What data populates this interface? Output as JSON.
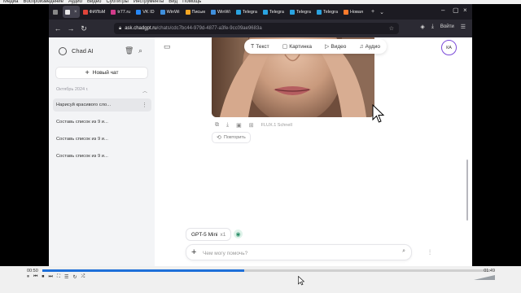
{
  "player": {
    "menu": [
      "Медиа",
      "Воспроизведение",
      "Аудио",
      "Видео",
      "Субтитры",
      "Инструменты",
      "Вид",
      "Помощь"
    ],
    "time_elapsed": "00:50",
    "time_total": "01:49",
    "progress_fraction": 0.45,
    "volume_label": "",
    "buttons": [
      "⏸",
      "⏮",
      "⏹",
      "⏭",
      "⛶",
      "☰",
      "↻",
      "⤮"
    ]
  },
  "browser": {
    "tabs": [
      {
        "title": "",
        "color": "#888888"
      },
      {
        "title": "",
        "color": "#e8e8e8"
      },
      {
        "title": "ФИЛЬМ",
        "color": "#e0443a"
      },
      {
        "title": "tr77.ru",
        "color": "#d23b8a"
      },
      {
        "title": "VK ID",
        "color": "#2787f5"
      },
      {
        "title": "WinWi",
        "color": "#3f8fdc"
      },
      {
        "title": "Письм",
        "color": "#f5a623"
      },
      {
        "title": "WinWi",
        "color": "#3f8fdc"
      },
      {
        "title": "Telegra",
        "color": "#2aa3e0"
      },
      {
        "title": "Telegra",
        "color": "#2aa3e0"
      },
      {
        "title": "Telegra",
        "color": "#2aa3e0"
      },
      {
        "title": "Telegra",
        "color": "#2aa3e0"
      },
      {
        "title": "Новая",
        "color": "#ff7b2c"
      }
    ],
    "url_host": "ask.chadgpt.ru",
    "url_path": "/chats/cdc7bc44-979d-4877-a3fe-9cc09ae9683a",
    "download_label": "Войти"
  },
  "sidebar": {
    "brand": "Chad AI",
    "new_chat": "Новый чат",
    "section": "Октябрь 2024 г.",
    "chats": [
      {
        "title": "Нарисуй красивого сло...",
        "selected": true
      },
      {
        "title": "Составь список из 9 и...",
        "selected": false
      },
      {
        "title": "Составь список из 9 и...",
        "selected": false
      },
      {
        "title": "Составь список из 9 и...",
        "selected": false
      }
    ]
  },
  "main": {
    "modes": [
      {
        "icon": "T",
        "label": "Текст"
      },
      {
        "icon": "▢",
        "label": "Картинка"
      },
      {
        "icon": "▷",
        "label": "Видео"
      },
      {
        "icon": "♫",
        "label": "Аудио"
      }
    ],
    "avatar": "КА",
    "image_model": "FLUX.1 Schnell",
    "retry": "Повторить",
    "model": "GPT-5 Mini",
    "model_count": "x1",
    "input_placeholder": "Чем могу помочь?"
  },
  "colors": {
    "accent": "#7b4bd9",
    "seek": "#1e6fd9"
  }
}
